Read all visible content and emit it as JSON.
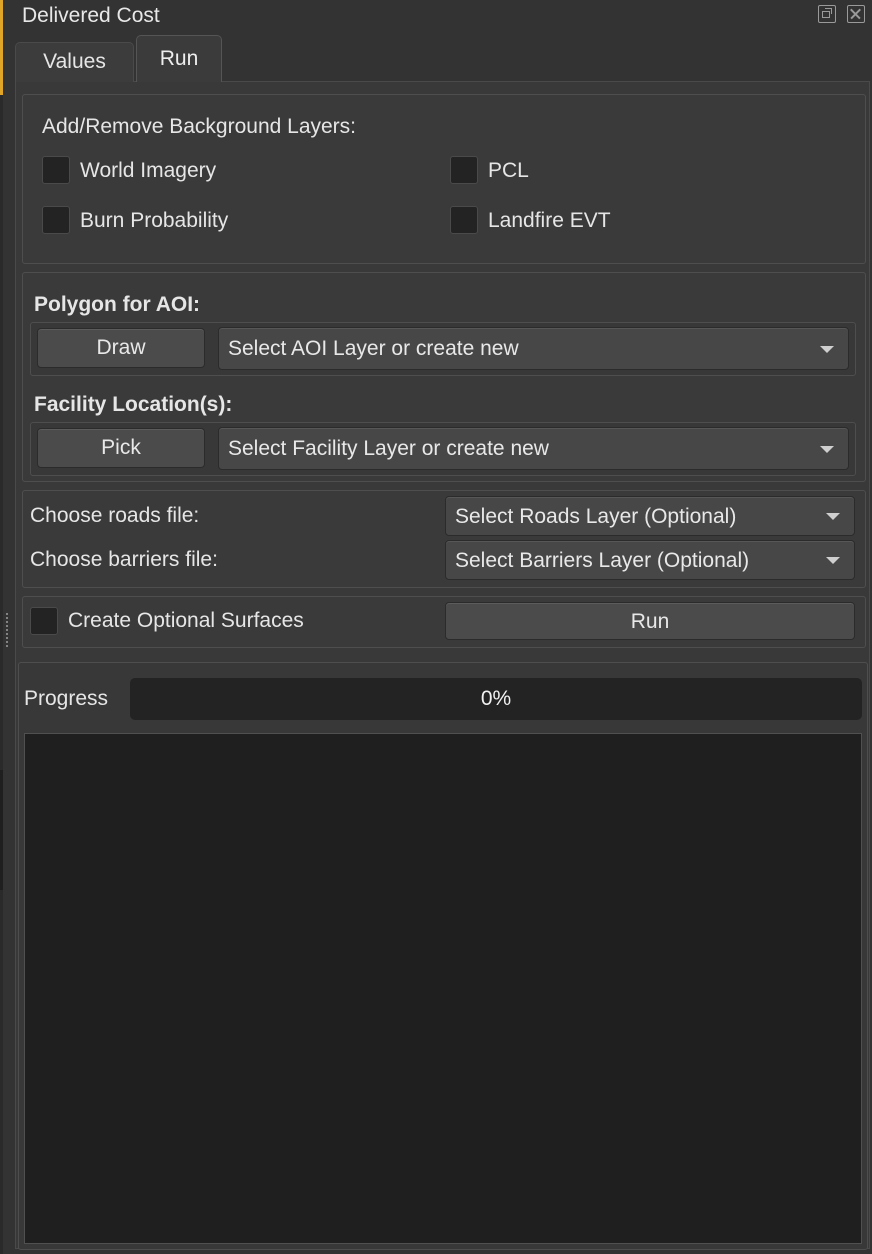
{
  "window": {
    "title": "Delivered Cost"
  },
  "tabs": [
    {
      "label": "Values",
      "active": false
    },
    {
      "label": "Run",
      "active": true
    }
  ],
  "background_layers": {
    "heading": "Add/Remove Background Layers:",
    "items": [
      {
        "label": "World Imagery",
        "checked": false
      },
      {
        "label": "PCL",
        "checked": false
      },
      {
        "label": "Burn Probability",
        "checked": false
      },
      {
        "label": "Landfire EVT",
        "checked": false
      }
    ]
  },
  "aoi": {
    "heading": "Polygon for AOI:",
    "button_label": "Draw",
    "combo_value": "Select AOI Layer or create new"
  },
  "facility": {
    "heading": "Facility Location(s):",
    "button_label": "Pick",
    "combo_value": "Select Facility Layer or create new"
  },
  "files": {
    "roads_label": "Choose roads file:",
    "roads_combo": "Select Roads Layer (Optional)",
    "barriers_label": "Choose barriers file:",
    "barriers_combo": "Select Barriers Layer (Optional)"
  },
  "options": {
    "optional_surfaces_label": "Create Optional Surfaces",
    "optional_surfaces_checked": false,
    "run_label": "Run"
  },
  "progress": {
    "label": "Progress",
    "value_text": "0%",
    "value": 0
  },
  "colors": {
    "accent": "#e0a526",
    "background": "#333333",
    "input_dark": "#232323"
  }
}
